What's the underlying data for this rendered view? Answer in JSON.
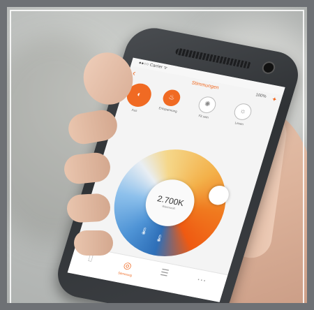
{
  "statusbar": {
    "carrier": "●●○○ Carrier ᯤ",
    "time": ""
  },
  "navbar": {
    "title": "Stimmungen",
    "percent": "100%"
  },
  "modes": [
    {
      "label": "Aus"
    },
    {
      "label": "Entspannung"
    },
    {
      "label": "Fit sein"
    },
    {
      "label": "Lesen"
    }
  ],
  "wheel": {
    "value": "2.700K",
    "sub": "Warmweiß"
  },
  "tabs": [
    {
      "label": ""
    },
    {
      "label": "Stimmung"
    },
    {
      "label": ""
    },
    {
      "label": ""
    }
  ],
  "colors": {
    "accent": "#f06a23"
  }
}
